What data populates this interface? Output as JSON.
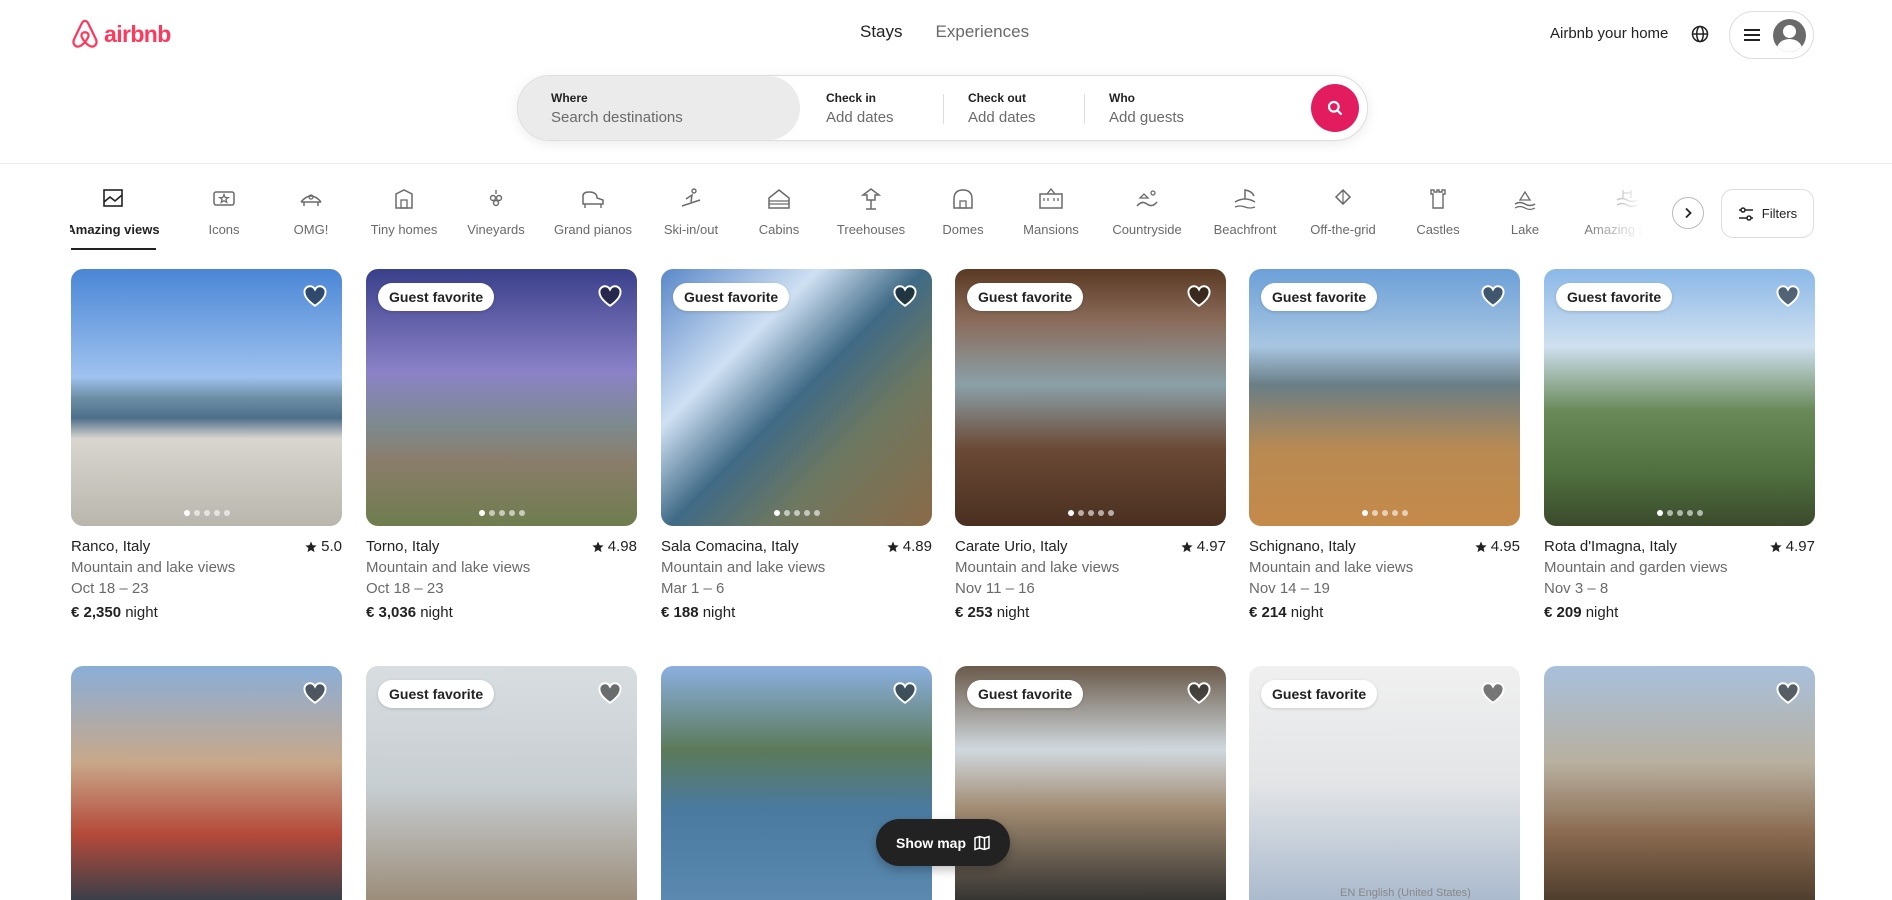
{
  "brand": {
    "name": "airbnb",
    "color": "#ff385c"
  },
  "top_nav": {
    "tabs": [
      "Stays",
      "Experiences"
    ],
    "active": "Stays",
    "host_link": "Airbnb your home",
    "globe_icon": "globe-icon",
    "menu_icon": "hamburger-icon"
  },
  "search": {
    "where_label": "Where",
    "where_placeholder": "Search destinations",
    "checkin_label": "Check in",
    "checkin_value": "Add dates",
    "checkout_label": "Check out",
    "checkout_value": "Add dates",
    "who_label": "Who",
    "who_value": "Add guests",
    "button_color": "#e31c5f"
  },
  "categories": [
    {
      "label": "Amazing views",
      "icon": "amazing-views-icon",
      "active": true
    },
    {
      "label": "Icons",
      "icon": "icons-icon"
    },
    {
      "label": "OMG!",
      "icon": "omg-icon"
    },
    {
      "label": "Tiny homes",
      "icon": "tiny-homes-icon"
    },
    {
      "label": "Vineyards",
      "icon": "vineyards-icon"
    },
    {
      "label": "Grand pianos",
      "icon": "grand-pianos-icon"
    },
    {
      "label": "Ski-in/out",
      "icon": "ski-icon"
    },
    {
      "label": "Cabins",
      "icon": "cabins-icon"
    },
    {
      "label": "Treehouses",
      "icon": "treehouses-icon"
    },
    {
      "label": "Domes",
      "icon": "domes-icon"
    },
    {
      "label": "Mansions",
      "icon": "mansions-icon"
    },
    {
      "label": "Countryside",
      "icon": "countryside-icon"
    },
    {
      "label": "Beachfront",
      "icon": "beachfront-icon"
    },
    {
      "label": "Off-the-grid",
      "icon": "off-the-grid-icon"
    },
    {
      "label": "Castles",
      "icon": "castles-icon"
    },
    {
      "label": "Lake",
      "icon": "lake-icon"
    },
    {
      "label": "Amazing pools",
      "icon": "pools-icon"
    }
  ],
  "filters_label": "Filters",
  "listings": [
    {
      "location": "Ranco, Italy",
      "rating": "5.0",
      "view": "Mountain and lake views",
      "dates": "Oct 18 – 23",
      "price": "€ 2,350",
      "unit": "night",
      "guest_favorite": false
    },
    {
      "location": "Torno, Italy",
      "rating": "4.98",
      "view": "Mountain and lake views",
      "dates": "Oct 18 – 23",
      "price": "€ 3,036",
      "unit": "night",
      "guest_favorite": true
    },
    {
      "location": "Sala Comacina, Italy",
      "rating": "4.89",
      "view": "Mountain and lake views",
      "dates": "Mar 1 – 6",
      "price": "€ 188",
      "unit": "night",
      "guest_favorite": true
    },
    {
      "location": "Carate Urio, Italy",
      "rating": "4.97",
      "view": "Mountain and lake views",
      "dates": "Nov 11 – 16",
      "price": "€ 253",
      "unit": "night",
      "guest_favorite": true
    },
    {
      "location": "Schignano, Italy",
      "rating": "4.95",
      "view": "Mountain and lake views",
      "dates": "Nov 14 – 19",
      "price": "€ 214",
      "unit": "night",
      "guest_favorite": true
    },
    {
      "location": "Rota d'Imagna, Italy",
      "rating": "4.97",
      "view": "Mountain and garden views",
      "dates": "Nov 3 – 8",
      "price": "€ 209",
      "unit": "night",
      "guest_favorite": true
    }
  ],
  "listings_row2": [
    {
      "guest_favorite": false
    },
    {
      "guest_favorite": true
    },
    {
      "guest_favorite": false
    },
    {
      "guest_favorite": true
    },
    {
      "guest_favorite": true
    },
    {
      "guest_favorite": false
    }
  ],
  "badge_text": "Guest favorite",
  "show_map_label": "Show map",
  "footer_lang": "EN English (United States)"
}
